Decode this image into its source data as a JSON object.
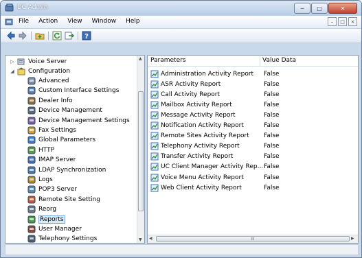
{
  "window": {
    "title": "UC Admin"
  },
  "menubar": {
    "items": [
      "File",
      "Action",
      "View",
      "Window",
      "Help"
    ]
  },
  "tree": {
    "root": "Voice Server",
    "configuration": "Configuration",
    "items": [
      {
        "label": "Advanced",
        "icon": "advanced-icon"
      },
      {
        "label": "Custom Interface Settings",
        "icon": "custom-interface-icon"
      },
      {
        "label": "Dealer Info",
        "icon": "dealer-info-icon"
      },
      {
        "label": "Device Management",
        "icon": "device-management-icon"
      },
      {
        "label": "Device Management Settings",
        "icon": "device-settings-icon"
      },
      {
        "label": "Fax Settings",
        "icon": "fax-icon"
      },
      {
        "label": "Global Parameters",
        "icon": "globe-icon"
      },
      {
        "label": "HTTP",
        "icon": "http-icon"
      },
      {
        "label": "IMAP Server",
        "icon": "imap-icon"
      },
      {
        "label": "LDAP Synchronization",
        "icon": "ldap-icon"
      },
      {
        "label": "Logs",
        "icon": "logs-icon"
      },
      {
        "label": "POP3 Server",
        "icon": "pop3-icon"
      },
      {
        "label": "Remote Site Setting",
        "icon": "remote-site-icon"
      },
      {
        "label": "Reorg",
        "icon": "reorg-icon"
      },
      {
        "label": "Reports",
        "icon": "reports-icon"
      },
      {
        "label": "User Manager",
        "icon": "user-manager-icon"
      },
      {
        "label": "Telephony Settings",
        "icon": "telephony-icon"
      }
    ],
    "selected": "Reports"
  },
  "list": {
    "columns": [
      "Parameters",
      "Value Data"
    ],
    "rows": [
      {
        "name": "Administration Activity Report",
        "value": "False"
      },
      {
        "name": "ASR Activity Report",
        "value": "False"
      },
      {
        "name": "Call Activity Report",
        "value": "False"
      },
      {
        "name": "Mailbox Activity Report",
        "value": "False"
      },
      {
        "name": "Message Activity Report",
        "value": "False"
      },
      {
        "name": "Notification Activity Report",
        "value": "False"
      },
      {
        "name": "Remote Sites Activity Report",
        "value": "False"
      },
      {
        "name": "Telephony Activity Report",
        "value": "False"
      },
      {
        "name": "Transfer Activity Report",
        "value": "False"
      },
      {
        "name": "UC Client Manager Activity Rep...",
        "value": "False"
      },
      {
        "name": "Voice Menu Activity Report",
        "value": "False"
      },
      {
        "name": "Web Client Activity Report",
        "value": "False"
      }
    ]
  },
  "colors": {
    "accent": "#3f6fb5",
    "selection": "#dbe9f8"
  }
}
